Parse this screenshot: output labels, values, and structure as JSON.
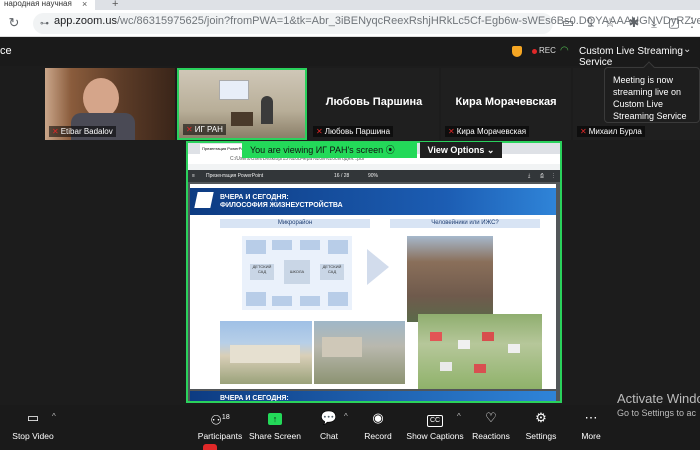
{
  "browser": {
    "tab_title": "народная научная",
    "url_host": "app.zoom.us",
    "url_path": "/wc/86315975625/join?fromPWA=1&tk=Abr_3iBENyqcReexRshjHRkLc5Cf-Egb6w-sWEs6Bs0.DQYAAAAUGNVDyRZveDN...",
    "new_tab": "+"
  },
  "zoom": {
    "title_fragment": "ce",
    "rec_label": "REC",
    "stream_label": "Custom Live Streaming Service",
    "tooltip": "Meeting is now streaming live on Custom Live Streaming Service"
  },
  "participants": [
    {
      "name": "Etibar Badalov",
      "display": ""
    },
    {
      "name": "ИГ РАН",
      "display": ""
    },
    {
      "name": "Любовь Паршина",
      "display": "Любовь Паршина"
    },
    {
      "name": "Кира Морачевская",
      "display": "Кира Морачевская"
    },
    {
      "name": "Михаил Бурла",
      "display": ""
    }
  ],
  "share": {
    "viewing_text": "You are viewing  ИГ РАН's screen",
    "view_options": "View Options",
    "inner_url": "C:/Users/User/Desktop/15%20Вчера%20и%20сегодня...pdf",
    "ppt_label": "Презентация PowerPoint",
    "page_info": "16 / 28",
    "zoom_level": "90%",
    "slide_title_line1": "ВЧЕРА И СЕГОДНЯ:",
    "slide_title_line2": "ФИЛОСОФИЯ ЖИЗНЕУСТРОЙСТВА",
    "section_left": "Микрорайон",
    "section_right": "Человейники или ИЖС?",
    "center_label": "ШКОЛА",
    "left_label": "ДЕТСКИЙ САД",
    "right_label": "ДЕТСКИЙ САД",
    "next_slide_title": "ВЧЕРА И СЕГОДНЯ:"
  },
  "toolbar": {
    "items": [
      {
        "label": "Stop Video",
        "icon": "video-camera-icon"
      },
      {
        "label": "Participants",
        "icon": "participants-icon",
        "count": "18"
      },
      {
        "label": "Share Screen",
        "icon": "share-screen-icon"
      },
      {
        "label": "Chat",
        "icon": "chat-icon"
      },
      {
        "label": "Record",
        "icon": "record-icon"
      },
      {
        "label": "Show Captions",
        "icon": "captions-icon"
      },
      {
        "label": "Reactions",
        "icon": "heart-icon"
      },
      {
        "label": "Settings",
        "icon": "gear-icon"
      },
      {
        "label": "More",
        "icon": "more-icon"
      }
    ]
  },
  "windows": {
    "activate_title": "Activate Windo",
    "activate_sub": "Go to Settings to ac"
  },
  "colors": {
    "share_green": "#23d959",
    "accent_green": "#2ad15c",
    "rec_red": "#e02828"
  }
}
